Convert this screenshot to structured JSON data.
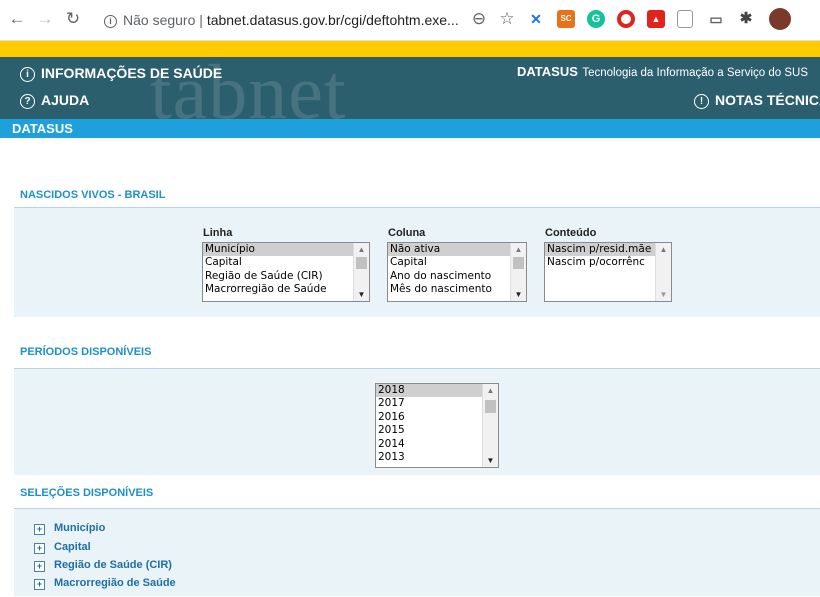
{
  "browser": {
    "security_label": "Não seguro",
    "url": "tabnet.datasus.gov.br/cgi/deftohtm.exe...",
    "extensions": [
      "x-extension-icon",
      "sc-extension-icon",
      "grammarly-icon",
      "opera-icon",
      "office-icon",
      "document-icon",
      "cast-icon",
      "puzzle-icon",
      "avatar"
    ],
    "ext_sc_label": "SC"
  },
  "header": {
    "watermark": "tabnet",
    "info_label": "INFORMAÇÕES DE SAÚDE",
    "help_label": "AJUDA",
    "brand": "DATASUS",
    "tagline": "Tecnologia da Informação a Serviço do SUS",
    "notes_label": "NOTAS TÉCNICA",
    "blue_bar_label": "DATASUS"
  },
  "sections": {
    "title": "NASCIDOS VIVOS - BRASIL",
    "periods": "PERÍODOS DISPONÍVEIS",
    "selections": "SELEÇÕES DISPONÍVEIS"
  },
  "linha": {
    "label": "Linha",
    "options": [
      "Município",
      "Capital",
      "Região de Saúde (CIR)",
      "Macrorregião de Saúde"
    ],
    "selected_index": 0
  },
  "coluna": {
    "label": "Coluna",
    "options": [
      "Não ativa",
      "Capital",
      "Ano do nascimento",
      "Mês do nascimento"
    ],
    "selected_index": 0
  },
  "conteudo": {
    "label": "Conteúdo",
    "options": [
      "Nascim p/resid.mãe",
      "Nascim p/ocorrênc"
    ],
    "selected_index": 0
  },
  "periodos": {
    "options": [
      "2018",
      "2017",
      "2016",
      "2015",
      "2014",
      "2013"
    ],
    "selected_index": 0
  },
  "tree": {
    "items": [
      "Município",
      "Capital",
      "Região de Saúde (CIR)",
      "Macrorregião de Saúde"
    ]
  }
}
